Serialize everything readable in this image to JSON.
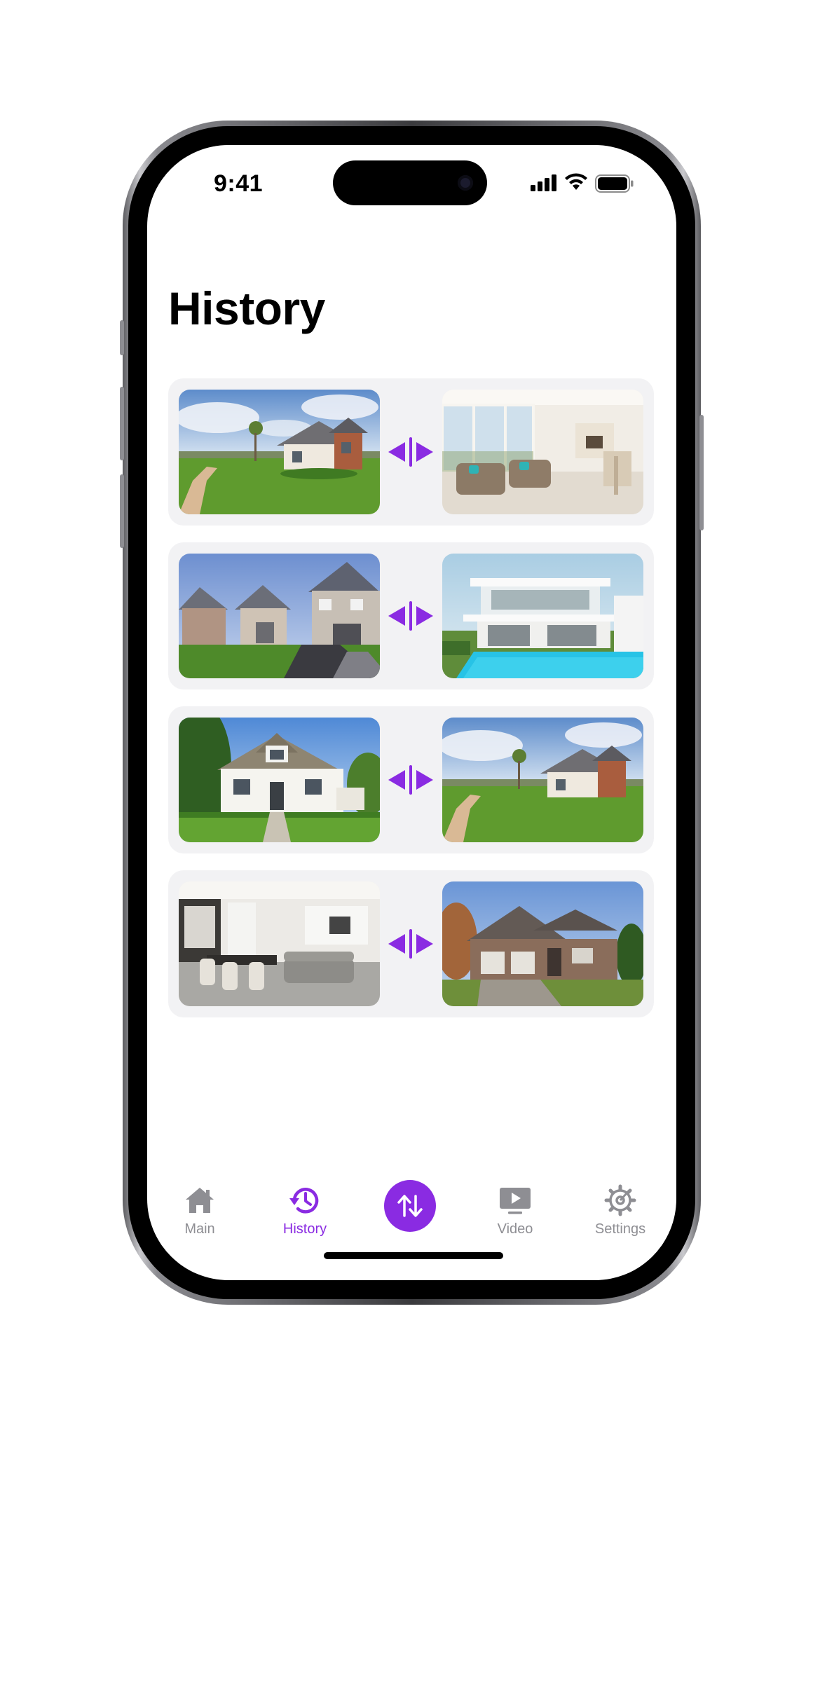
{
  "status_bar": {
    "time": "9:41"
  },
  "page": {
    "title": "History"
  },
  "history": [
    {
      "before": "house-exterior-lawn",
      "after": "living-room-interior"
    },
    {
      "before": "suburban-houses-row",
      "after": "modern-villa-pool"
    },
    {
      "before": "white-cottage",
      "after": "house-exterior-lawn"
    },
    {
      "before": "open-plan-dining-room",
      "after": "brick-house-garage"
    }
  ],
  "tab_bar": {
    "tabs": [
      {
        "label": "Main",
        "icon": "home-icon"
      },
      {
        "label": "History",
        "icon": "history-icon",
        "active": true
      },
      {
        "label": "",
        "icon": "swap-arrows-icon"
      },
      {
        "label": "Video",
        "icon": "video-play-icon"
      },
      {
        "label": "Settings",
        "icon": "gear-icon"
      }
    ]
  },
  "colors": {
    "accent": "#8a2be2",
    "card_bg": "#f2f2f4",
    "inactive": "#8e8e93"
  }
}
